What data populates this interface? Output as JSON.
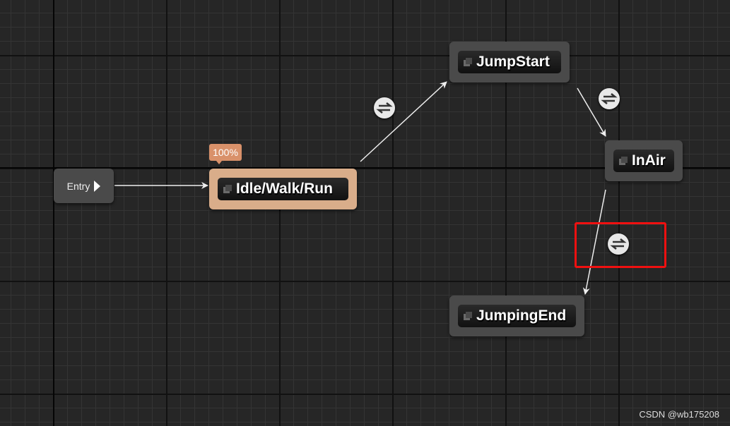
{
  "graph": {
    "entry": {
      "label": "Entry"
    },
    "states": [
      {
        "label": "Idle/Walk/Run",
        "active": true,
        "weight_badge": "100%"
      },
      {
        "label": "JumpStart"
      },
      {
        "label": "InAir"
      },
      {
        "label": "JumpingEnd"
      }
    ],
    "transitions": [
      {
        "from": "Entry",
        "to": "Idle/Walk/Run",
        "icon": "none"
      },
      {
        "from": "Idle/Walk/Run",
        "to": "JumpStart",
        "icon": "transition-rule-icon"
      },
      {
        "from": "JumpStart",
        "to": "InAir",
        "icon": "transition-rule-icon"
      },
      {
        "from": "InAir",
        "to": "JumpingEnd",
        "icon": "transition-rule-icon",
        "highlighted": true
      }
    ]
  },
  "colors": {
    "active_state": "#d9ad8a",
    "badge": "#d9916a",
    "highlight": "#f01010",
    "background": "#262626"
  },
  "watermark": "CSDN @wb175208"
}
